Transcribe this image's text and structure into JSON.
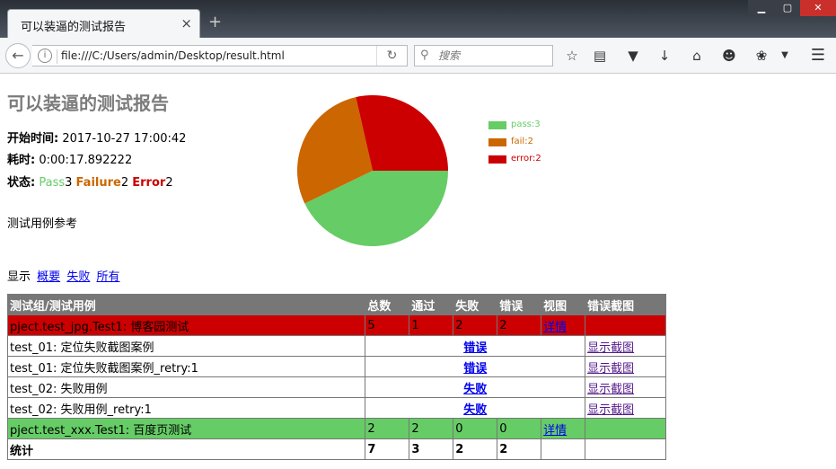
{
  "browser": {
    "tab_title": "可以装逼的测试报告",
    "tab_close": "×",
    "new_tab": "+",
    "window_controls": [
      "▁",
      "▢",
      "✕"
    ],
    "url": "file:///C:/Users/admin/Desktop/result.html",
    "search_placeholder": "搜索",
    "icons": [
      "back-arrow-icon",
      "info-icon",
      "reload-icon",
      "search-icon",
      "bookmark-star-icon",
      "reading-list-icon",
      "pocket-icon",
      "download-icon",
      "home-icon",
      "smiley-icon",
      "extension-icon",
      "dropdown-icon",
      "hamburger-menu-icon"
    ]
  },
  "report": {
    "title": "可以装逼的测试报告",
    "start_label": "开始时间:",
    "start_value": "2017-10-27 17:00:42",
    "duration_label": "耗时:",
    "duration_value": "0:00:17.892222",
    "status_label": "状态:",
    "status": {
      "pass_label": "Pass",
      "pass_count": "3",
      "failure_label": "Failure",
      "failure_count": "2",
      "error_label": "Error",
      "error_count": "2"
    },
    "description": "测试用例参考"
  },
  "chart_data": {
    "type": "pie",
    "slices": [
      {
        "name": "pass",
        "value": 3,
        "color": "#66cc66",
        "label": "pass:3"
      },
      {
        "name": "fail",
        "value": 2,
        "color": "#cc6600",
        "label": "fail:2"
      },
      {
        "name": "error",
        "value": 2,
        "color": "#cc0000",
        "label": "error:2"
      }
    ],
    "legend_placement": "right"
  },
  "filter": {
    "label": "显示",
    "summary": "概要",
    "failed": "失败",
    "all": "所有"
  },
  "table": {
    "headers": [
      "测试组/测试用例",
      "总数",
      "通过",
      "失败",
      "错误",
      "视图",
      "错误截图"
    ],
    "groups": [
      {
        "name": "pject.test_jpg.Test1: 博客园测试",
        "total": "5",
        "pass": "1",
        "fail": "2",
        "error": "2",
        "view": "详情",
        "status": "fail",
        "cases": [
          {
            "name": "test_01: 定位失败截图案例",
            "result": "错误",
            "screenshot": "显示截图"
          },
          {
            "name": "test_01: 定位失败截图案例_retry:1",
            "result": "错误",
            "screenshot": "显示截图"
          },
          {
            "name": "test_02: 失败用例",
            "result": "失败",
            "screenshot": "显示截图"
          },
          {
            "name": "test_02: 失败用例_retry:1",
            "result": "失败",
            "screenshot": "显示截图"
          }
        ]
      },
      {
        "name": "pject.test_xxx.Test1: 百度页测试",
        "total": "2",
        "pass": "2",
        "fail": "0",
        "error": "0",
        "view": "详情",
        "status": "pass",
        "cases": []
      }
    ],
    "total_row": {
      "label": "统计",
      "total": "7",
      "pass": "3",
      "fail": "2",
      "error": "2"
    }
  }
}
